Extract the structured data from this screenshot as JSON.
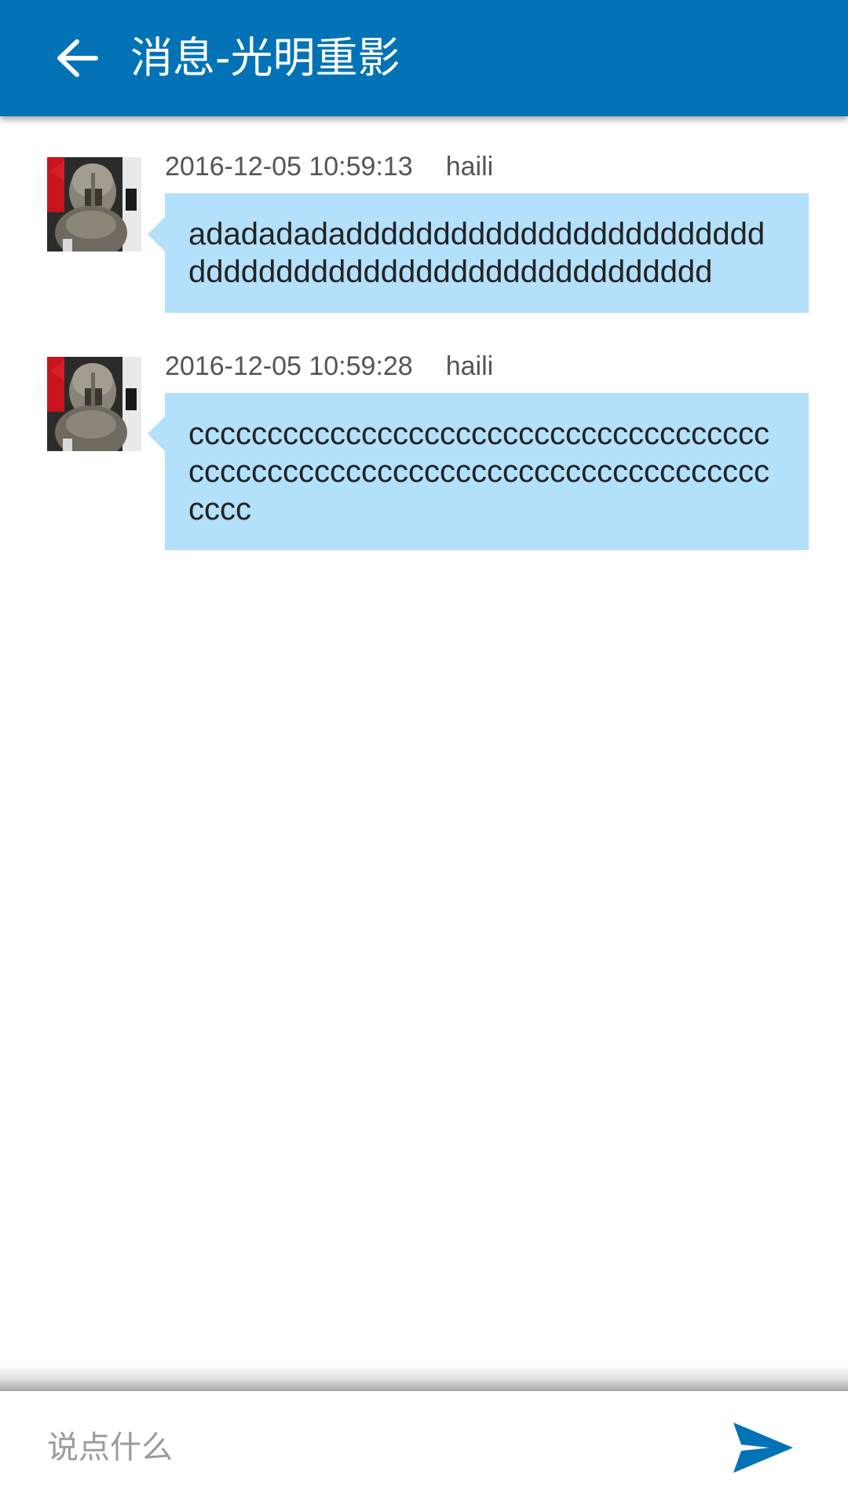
{
  "header": {
    "title": "消息-光明重影",
    "back_icon": "arrow-left-icon"
  },
  "messages": [
    {
      "timestamp": "2016-12-05 10:59:13",
      "sender": "haili",
      "text": "adadadadadddddddddddddddddddddddddddddddddddddddddddddddddddddd"
    },
    {
      "timestamp": "2016-12-05 10:59:28",
      "sender": "haili",
      "text": "cccccccccccccccccccccccccccccccccccccccccccccccccccccccccccccccccccccccccccccc"
    }
  ],
  "composer": {
    "placeholder": "说点什么",
    "send_icon": "send-icon"
  },
  "colors": {
    "header_bg": "#0072B5",
    "bubble_bg": "#B3E0FA",
    "send_icon": "#0072B5"
  }
}
